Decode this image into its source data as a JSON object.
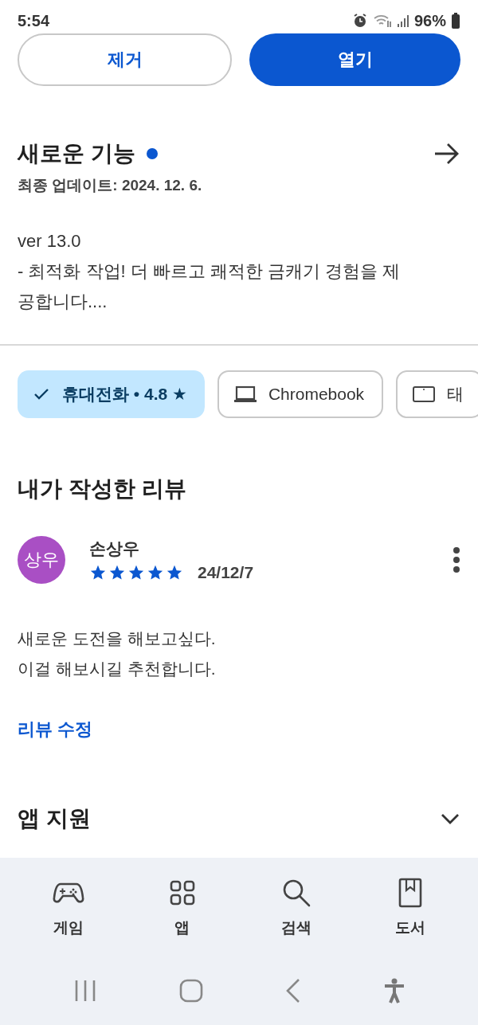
{
  "status_bar": {
    "time": "5:54",
    "battery": "96%"
  },
  "actions": [
    {
      "label": "제거",
      "kind": "outline"
    },
    {
      "label": "열기",
      "kind": "filled"
    }
  ],
  "whats_new": {
    "title": "새로운 기능",
    "unread": true,
    "updated": "최종 업데이트: 2024. 12. 6.",
    "version": "ver 13.0",
    "description": "- 최적화 작업! 더 빠르고 쾌적한 금캐기 경험을 제공합니다...."
  },
  "device_chips": [
    {
      "label": "휴대전화 • 4.8 ★",
      "kind": "phone",
      "selected": true
    },
    {
      "label": "Chromebook",
      "kind": "laptop",
      "selected": false
    },
    {
      "label": "태",
      "kind": "tablet",
      "selected": false
    }
  ],
  "my_review": {
    "heading": "내가 작성한 리뷰",
    "avatar": "상우",
    "author": "손상우",
    "stars": 5,
    "date": "24/12/7",
    "text": "새로운 도전을 해보고싶다.\n이걸 해보시길 추천합니다.",
    "edit_link": "리뷰 수정"
  },
  "app_support": {
    "title": "앱 지원",
    "expanded": false
  },
  "bottom_nav": [
    {
      "label": "게임",
      "kind": "games"
    },
    {
      "label": "앱",
      "kind": "apps"
    },
    {
      "label": "검색",
      "kind": "search"
    },
    {
      "label": "도서",
      "kind": "books"
    }
  ]
}
